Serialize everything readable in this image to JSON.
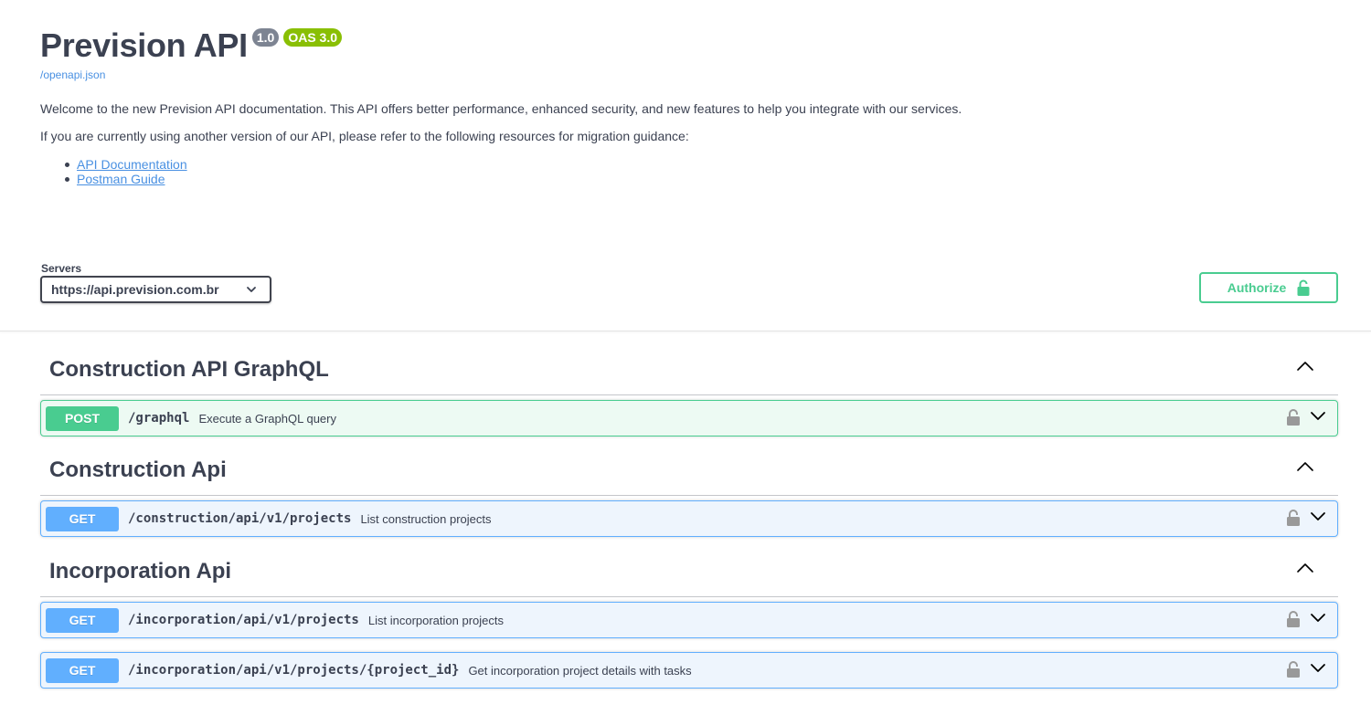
{
  "info": {
    "title": "Prevision API",
    "version": "1.0",
    "oas": "OAS 3.0",
    "spec_link": "/openapi.json",
    "description_1": "Welcome to the new Prevision API documentation. This API offers better performance, enhanced security, and new features to help you integrate with our services.",
    "description_2": "If you are currently using another version of our API, please refer to the following resources for migration guidance:",
    "links": [
      "API Documentation",
      "Postman Guide"
    ]
  },
  "servers": {
    "label": "Servers",
    "selected": "https://api.prevision.com.br"
  },
  "authorize": {
    "label": "Authorize"
  },
  "tags": [
    {
      "name": "Construction API GraphQL",
      "operations": [
        {
          "method": "POST",
          "path": "/graphql",
          "summary": "Execute a GraphQL query"
        }
      ]
    },
    {
      "name": "Construction Api",
      "operations": [
        {
          "method": "GET",
          "path": "/construction/api/v1/projects",
          "summary": "List construction projects"
        }
      ]
    },
    {
      "name": "Incorporation Api",
      "operations": [
        {
          "method": "GET",
          "path": "/incorporation/api/v1/projects",
          "summary": "List incorporation projects"
        },
        {
          "method": "GET",
          "path": "/incorporation/api/v1/projects/{project_id}",
          "summary": "Get incorporation project details with tasks"
        }
      ]
    }
  ],
  "colors": {
    "post": "#49cc90",
    "get": "#61affe",
    "text": "#3b4151",
    "link": "#4990e2"
  }
}
